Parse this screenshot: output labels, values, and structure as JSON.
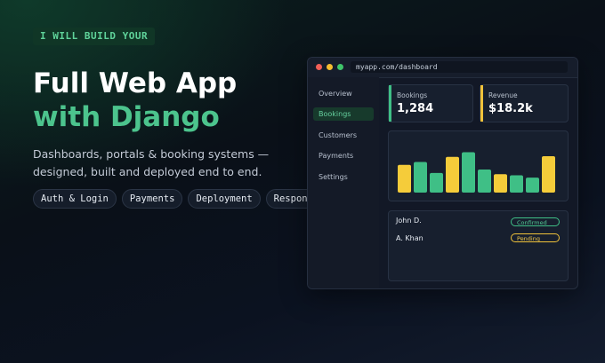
{
  "hero": {
    "tag": "I WILL BUILD YOUR",
    "title_line1": "Full Web App",
    "title_line2": "with Django",
    "description": "Dashboards, portals & booking systems — designed, built and deployed end to end.",
    "pills": [
      "Auth & Login",
      "Payments",
      "Deployment",
      "Responsive"
    ]
  },
  "colors": {
    "accent_green": "#4cc48d",
    "accent_yellow": "#f0c23a",
    "background": "#0a1018"
  },
  "window": {
    "url": "myapp.com/dashboard",
    "nav": [
      "Overview",
      "Bookings",
      "Customers",
      "Payments",
      "Settings"
    ],
    "active_nav": "Bookings",
    "stats": [
      {
        "label": "Bookings",
        "value": "1,284",
        "color": "#3fbf86"
      },
      {
        "label": "Revenue",
        "value": "$18.2k",
        "color": "#f0c23a"
      }
    ],
    "rows": [
      {
        "name": "John D.",
        "status": "Confirmed",
        "status_color": "#3fbf86"
      },
      {
        "name": "A. Khan",
        "status": "Pending",
        "status_color": "#f0c23a"
      }
    ]
  },
  "chart_data": {
    "type": "bar",
    "values": [
      48,
      53,
      34,
      62,
      70,
      40,
      32,
      30,
      26,
      63
    ],
    "colors": [
      "#f5cc3a",
      "#3fbf86",
      "#3fbf86",
      "#f5cc3a",
      "#3fbf86",
      "#3fbf86",
      "#f5cc3a",
      "#3fbf86",
      "#3fbf86",
      "#f5cc3a"
    ],
    "ylim": [
      0,
      100
    ]
  }
}
